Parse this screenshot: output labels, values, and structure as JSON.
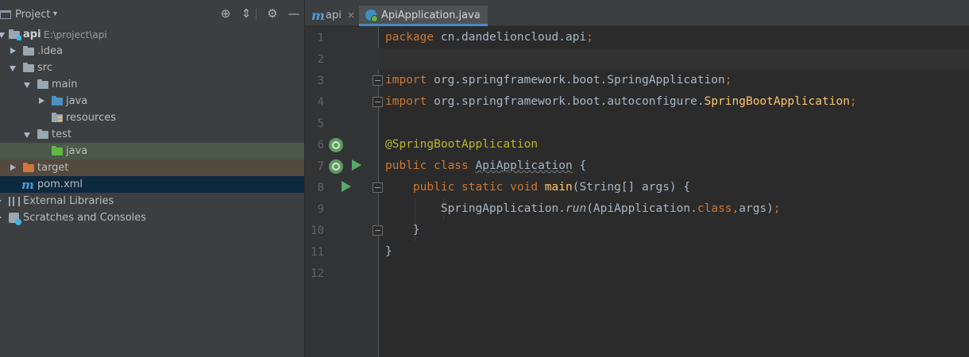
{
  "project_panel": {
    "title": "Project",
    "dropdown": "▾",
    "tree": [
      {
        "label": "api",
        "path": "E:\\project\\api"
      },
      {
        "label": ".idea"
      },
      {
        "label": "src"
      },
      {
        "label": "main"
      },
      {
        "label": "java"
      },
      {
        "label": "resources"
      },
      {
        "label": "test"
      },
      {
        "label": "java"
      },
      {
        "label": "target"
      },
      {
        "label": "pom.xml"
      },
      {
        "label": "External Libraries"
      },
      {
        "label": "Scratches and Consoles"
      }
    ]
  },
  "tabs": [
    {
      "label": "api",
      "close": "×"
    },
    {
      "label": "ApiApplication.java",
      "close": "×"
    }
  ],
  "editor": {
    "line_numbers": [
      "1",
      "2",
      "3",
      "4",
      "5",
      "6",
      "7",
      "8",
      "9",
      "10",
      "11",
      "12"
    ],
    "code": {
      "l1_kw": "package",
      "l1_rest": " cn.dandelioncloud.api",
      "l1_semi": ";",
      "l3_kw": "import",
      "l3_rest": " org.springframework.boot.SpringApplication",
      "l3_semi": ";",
      "l4_kw": "import",
      "l4_rest": " org.springframework.boot.autoconfigure.",
      "l4_cls": "SpringBootApplication",
      "l4_semi": ";",
      "l6_ann": "@SpringBootApplication",
      "l7_kw": "public class",
      "l7_cls": "ApiApplication",
      "l7_rest": " {",
      "l8_kw": "public static void",
      "l8_mth": "main",
      "l8_rest": "(String[] args) {",
      "l9_a": "SpringApplication.",
      "l9_run": "run",
      "l9_b": "(ApiApplication.",
      "l9_class": "class,",
      "l9_c": "args)",
      "l9_semi": ";",
      "l10": "}",
      "l11": "}"
    }
  },
  "colors": {
    "keyword": "#cc7832",
    "annotation": "#bbb529",
    "method": "#ffc66d",
    "text": "#a9b7c6",
    "selection_green": "#4a5949",
    "selection_blue": "#0d293e"
  }
}
